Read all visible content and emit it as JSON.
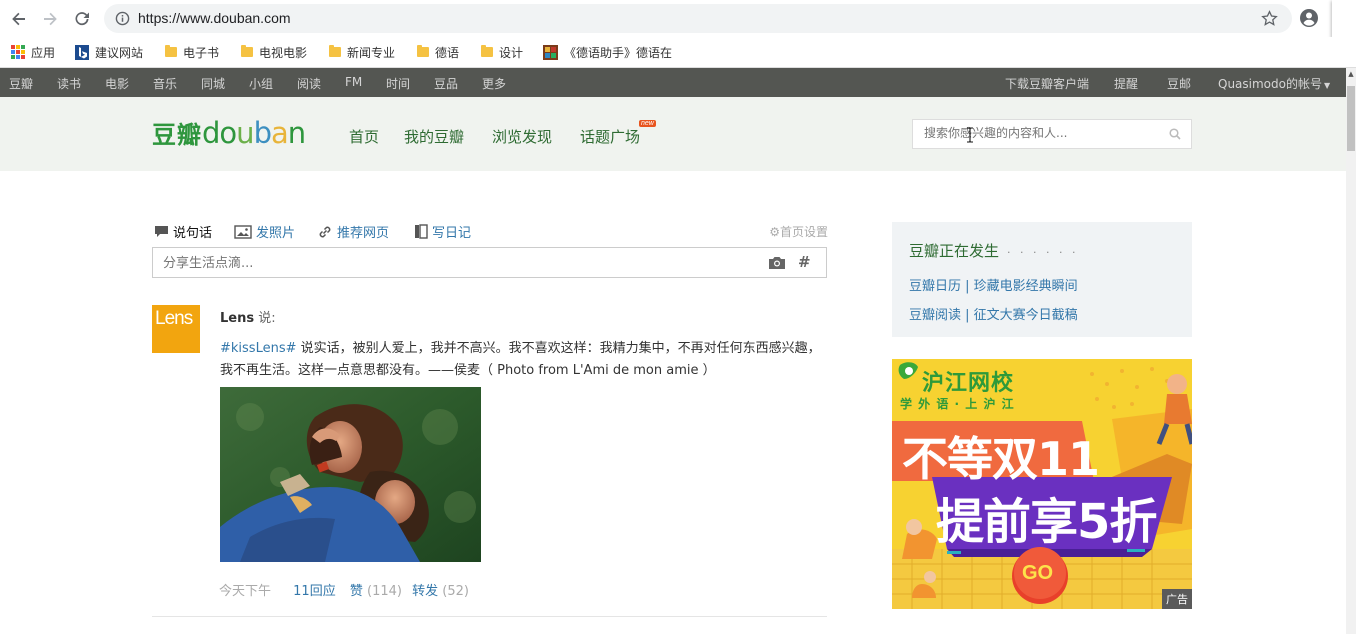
{
  "browser": {
    "url": "https://www.douban.com",
    "bookmarks": [
      "应用",
      "建议网站",
      "电子书",
      "电视电影",
      "新闻专业",
      "德语",
      "设计",
      "《德语助手》德语在"
    ]
  },
  "global_nav": {
    "left": [
      "豆瓣",
      "读书",
      "电影",
      "音乐",
      "同城",
      "小组",
      "阅读",
      "FM",
      "时间",
      "豆品",
      "更多"
    ],
    "right": [
      "下载豆瓣客户端",
      "提醒",
      "豆邮",
      "Quasimodo的帐号"
    ]
  },
  "header": {
    "logo_cn": "豆瓣",
    "logo_en": "douban",
    "nav": [
      "首页",
      "我的豆瓣",
      "浏览发现",
      "话题广场"
    ],
    "new_badge": "new",
    "search_placeholder": "搜索你感兴趣的内容和人..."
  },
  "composer": {
    "tabs": [
      "说句话",
      "发照片",
      "推荐网页",
      "写日记"
    ],
    "settings": "首页设置",
    "placeholder": "分享生活点滴...",
    "hash": "#"
  },
  "status": {
    "avatar_text": "Lens",
    "author": "Lens",
    "verb": "说:",
    "tag": "#kissLens#",
    "text": " 说实话，被别人爱上，我并不高兴。我不喜欢这样：我精力集中，不再对任何东西感兴趣，我不再生活。这样一点意思都没有。——侯麦（ Photo from L'Ami de mon amie ）",
    "time": "今天下午",
    "replies": "11回应",
    "like": "赞",
    "like_count": "(114)",
    "repost": "转发",
    "repost_count": "(52)"
  },
  "sidebar": {
    "title": "豆瓣正在发生",
    "dots": "· · · · · ·",
    "links": [
      "豆瓣日历 | 珍藏电影经典瞬间",
      "豆瓣阅读 | 征文大赛今日截稿"
    ],
    "ad": {
      "brand": "沪江网校",
      "slogan": "学 外 语 · 上 沪 江",
      "headline1": "不等双11",
      "headline2": "提前享5折",
      "button": "GO",
      "label": "广告"
    }
  }
}
